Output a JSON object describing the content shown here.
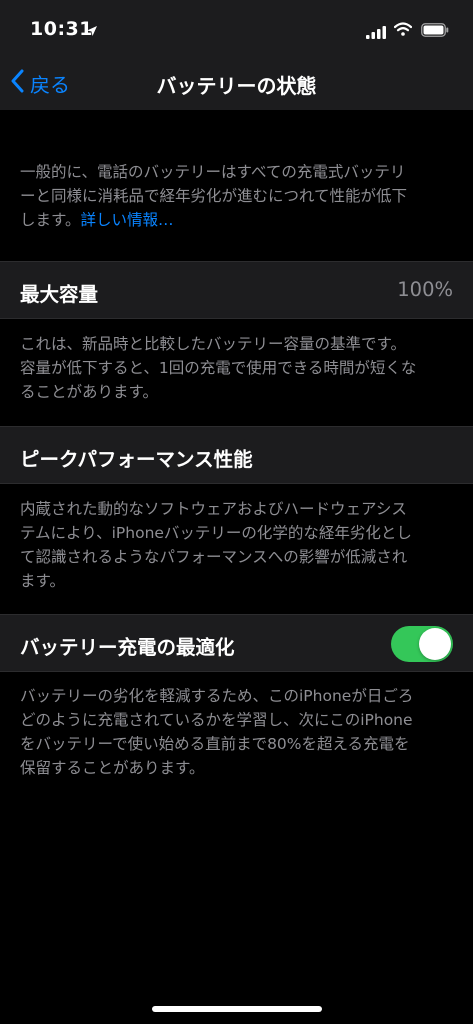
{
  "status_bar": {
    "time": "10:31",
    "icons": [
      "location-icon",
      "signal-icon",
      "wifi-icon",
      "battery-icon"
    ]
  },
  "nav": {
    "back_label": "戻る",
    "title": "バッテリーの状態"
  },
  "intro": {
    "text_line1": "一般的に、電話のバッテリーはすべての充電式バッテリ",
    "text_line2": "ーと同様に消耗品で経年劣化が進むにつれて性能が低下",
    "text_line3_prefix": "します。",
    "link_label": "詳しい情報…"
  },
  "max_capacity": {
    "label": "最大容量",
    "value": "100%",
    "description_line1": "これは、新品時と比較したバッテリー容量の基準です。",
    "description_line2": "容量が低下すると、1回の充電で使用できる時間が短くな",
    "description_line3": "ることがあります。"
  },
  "peak_performance": {
    "label": "ピークパフォーマンス性能",
    "description_line1": "内蔵された動的なソフトウェアおよびハードウェアシス",
    "description_line2": "テムにより、iPhoneバッテリーの化学的な経年劣化とし",
    "description_line3": "て認識されるようなパフォーマンスへの影響が低減され",
    "description_line4": "ます。"
  },
  "optimized_charging": {
    "label": "バッテリー充電の最適化",
    "enabled": true,
    "description_line1": "バッテリーの劣化を軽減するため、このiPhoneが日ごろ",
    "description_line2": "どのように充電されているかを学習し、次にこのiPhone",
    "description_line3": "をバッテリーで使い始める直前まで80%を超える充電を",
    "description_line4": "保留することがあります。"
  },
  "colors": {
    "accent": "#0a84ff",
    "toggle_on": "#34c759",
    "background": "#000000",
    "cell_background": "#1c1c1e",
    "secondary_text": "#8e8e93"
  }
}
